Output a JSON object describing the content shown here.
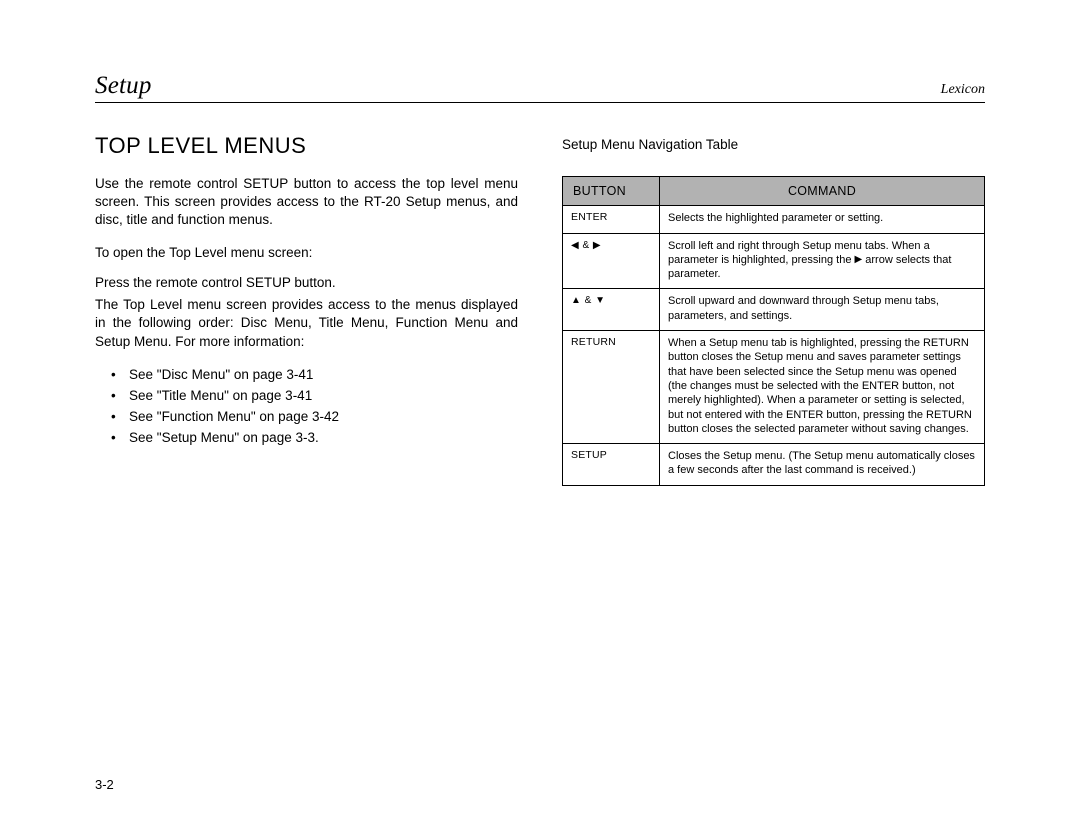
{
  "header": {
    "left": "Setup",
    "right": "Lexicon"
  },
  "left_col": {
    "title": "TOP LEVEL MENUS",
    "intro": "Use the remote control SETUP button to access the top level menu screen. This screen provides access to the RT-20 Setup menus, and disc, title and function menus.",
    "open_label": "To open the Top Level menu screen:",
    "press": "Press the remote control SETUP button.",
    "desc": "The Top Level menu screen provides access to the menus displayed in the following order: Disc Menu, Title Menu, Function Menu and Setup Menu. For more information:",
    "bullets": [
      "See \"Disc Menu\" on page 3-41",
      "See \"Title Menu\" on page 3-41",
      "See \"Function Menu\" on page 3-42",
      "See \"Setup Menu\" on page 3-3."
    ]
  },
  "right_col": {
    "caption": "Setup Menu Navigation Table",
    "th_button": "BUTTON",
    "th_command": "COMMAND",
    "rows": [
      {
        "button_text": "ENTER",
        "button_glyph": "",
        "command": "Selects the highlighted parameter or setting."
      },
      {
        "button_text": "",
        "button_glyph": "◀ & ▶",
        "command_pre": "Scroll left and right through Setup menu tabs. When a parameter is highlighted, pressing the ",
        "command_arrow": "▶",
        "command_post": " arrow selects that parameter."
      },
      {
        "button_text": "",
        "button_glyph": "▲ & ▼",
        "command": "Scroll upward and downward through Setup menu tabs, parameters, and settings."
      },
      {
        "button_text": "RETURN",
        "button_glyph": "",
        "command": "When a Setup menu tab is highlighted, pressing the RETURN button closes the Setup menu and saves parameter settings that have been selected since the Setup menu was opened (the changes must be selected with the ENTER button, not merely highlighted). When a parameter or setting is selected, but not entered with the ENTER button, pressing the RETURN button closes the selected parameter without saving changes."
      },
      {
        "button_text": "SETUP",
        "button_glyph": "",
        "command": "Closes the Setup menu. (The Setup menu automatically closes a few seconds after the last command is received.)"
      }
    ]
  },
  "page_number": "3-2"
}
